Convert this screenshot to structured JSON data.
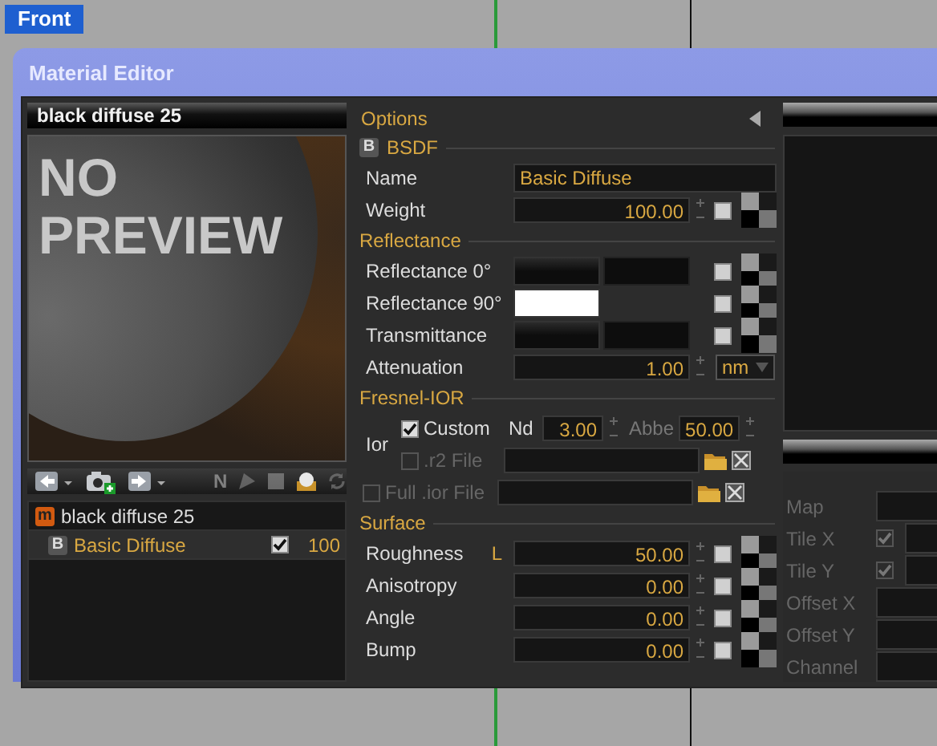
{
  "viewport": {
    "label": "Front"
  },
  "window": {
    "title": "Material Editor"
  },
  "material": {
    "title": "black diffuse 25",
    "preview_text": "NO PREVIEW"
  },
  "toolbar": [
    {
      "kind": "back",
      "disabled": false
    },
    {
      "kind": "camera",
      "disabled": false
    },
    {
      "kind": "forward",
      "disabled": false
    },
    {
      "kind": "letter",
      "label": "N",
      "disabled": true
    },
    {
      "kind": "triangle",
      "disabled": true
    },
    {
      "kind": "square",
      "disabled": true
    },
    {
      "kind": "sphere",
      "disabled": false
    },
    {
      "kind": "refresh",
      "disabled": true
    }
  ],
  "tree": [
    {
      "badge": "m",
      "label": "black diffuse 25",
      "selected": false,
      "children": [
        {
          "badge": "B",
          "label": "Basic Diffuse",
          "checked": true,
          "value": "100",
          "selected": true
        }
      ]
    }
  ],
  "options": {
    "title": "Options"
  },
  "sections": [
    {
      "title": "BSDF",
      "badge": "B",
      "rows": [
        {
          "kind": "text",
          "label": "Name",
          "value": "Basic Diffuse"
        },
        {
          "kind": "number",
          "label": "Weight",
          "value": "100.00"
        }
      ]
    },
    {
      "title": "Reflectance",
      "rows": [
        {
          "kind": "color_pair",
          "label": "Reflectance 0°",
          "color": "#0d0d0d"
        },
        {
          "kind": "color",
          "label": "Reflectance 90°",
          "color": "#ffffff"
        },
        {
          "kind": "color_pair",
          "label": "Transmittance",
          "color": "#0d0d0d"
        },
        {
          "kind": "number_unit",
          "label": "Attenuation",
          "value": "1.00",
          "unit": "nm"
        }
      ]
    },
    {
      "title": "Fresnel-IOR",
      "rows": [
        {
          "kind": "ior",
          "label": "Ior",
          "custom": {
            "label": "Custom",
            "checked": true,
            "nd_label": "Nd",
            "nd": "3.00",
            "abbe_label": "Abbe",
            "abbe": "50.00"
          },
          "files": [
            {
              "label": ".r2 File",
              "checked": false
            },
            {
              "label": "Full .ior File",
              "checked": false
            }
          ]
        }
      ]
    },
    {
      "title": "Surface",
      "rows": [
        {
          "kind": "number",
          "label": "Roughness",
          "tag": "L",
          "value": "50.00"
        },
        {
          "kind": "number",
          "label": "Anisotropy",
          "value": "0.00"
        },
        {
          "kind": "number",
          "label": "Angle",
          "value": "0.00"
        },
        {
          "kind": "number",
          "label": "Bump",
          "value": "0.00"
        }
      ]
    }
  ],
  "texture": {
    "properties": [
      {
        "kind": "field",
        "label": "Map"
      },
      {
        "kind": "check_field",
        "label": "Tile X",
        "checked": true
      },
      {
        "kind": "check_field",
        "label": "Tile Y",
        "checked": true
      },
      {
        "kind": "field",
        "label": "Offset X"
      },
      {
        "kind": "field",
        "label": "Offset Y"
      },
      {
        "kind": "field",
        "label": "Channel"
      }
    ]
  }
}
